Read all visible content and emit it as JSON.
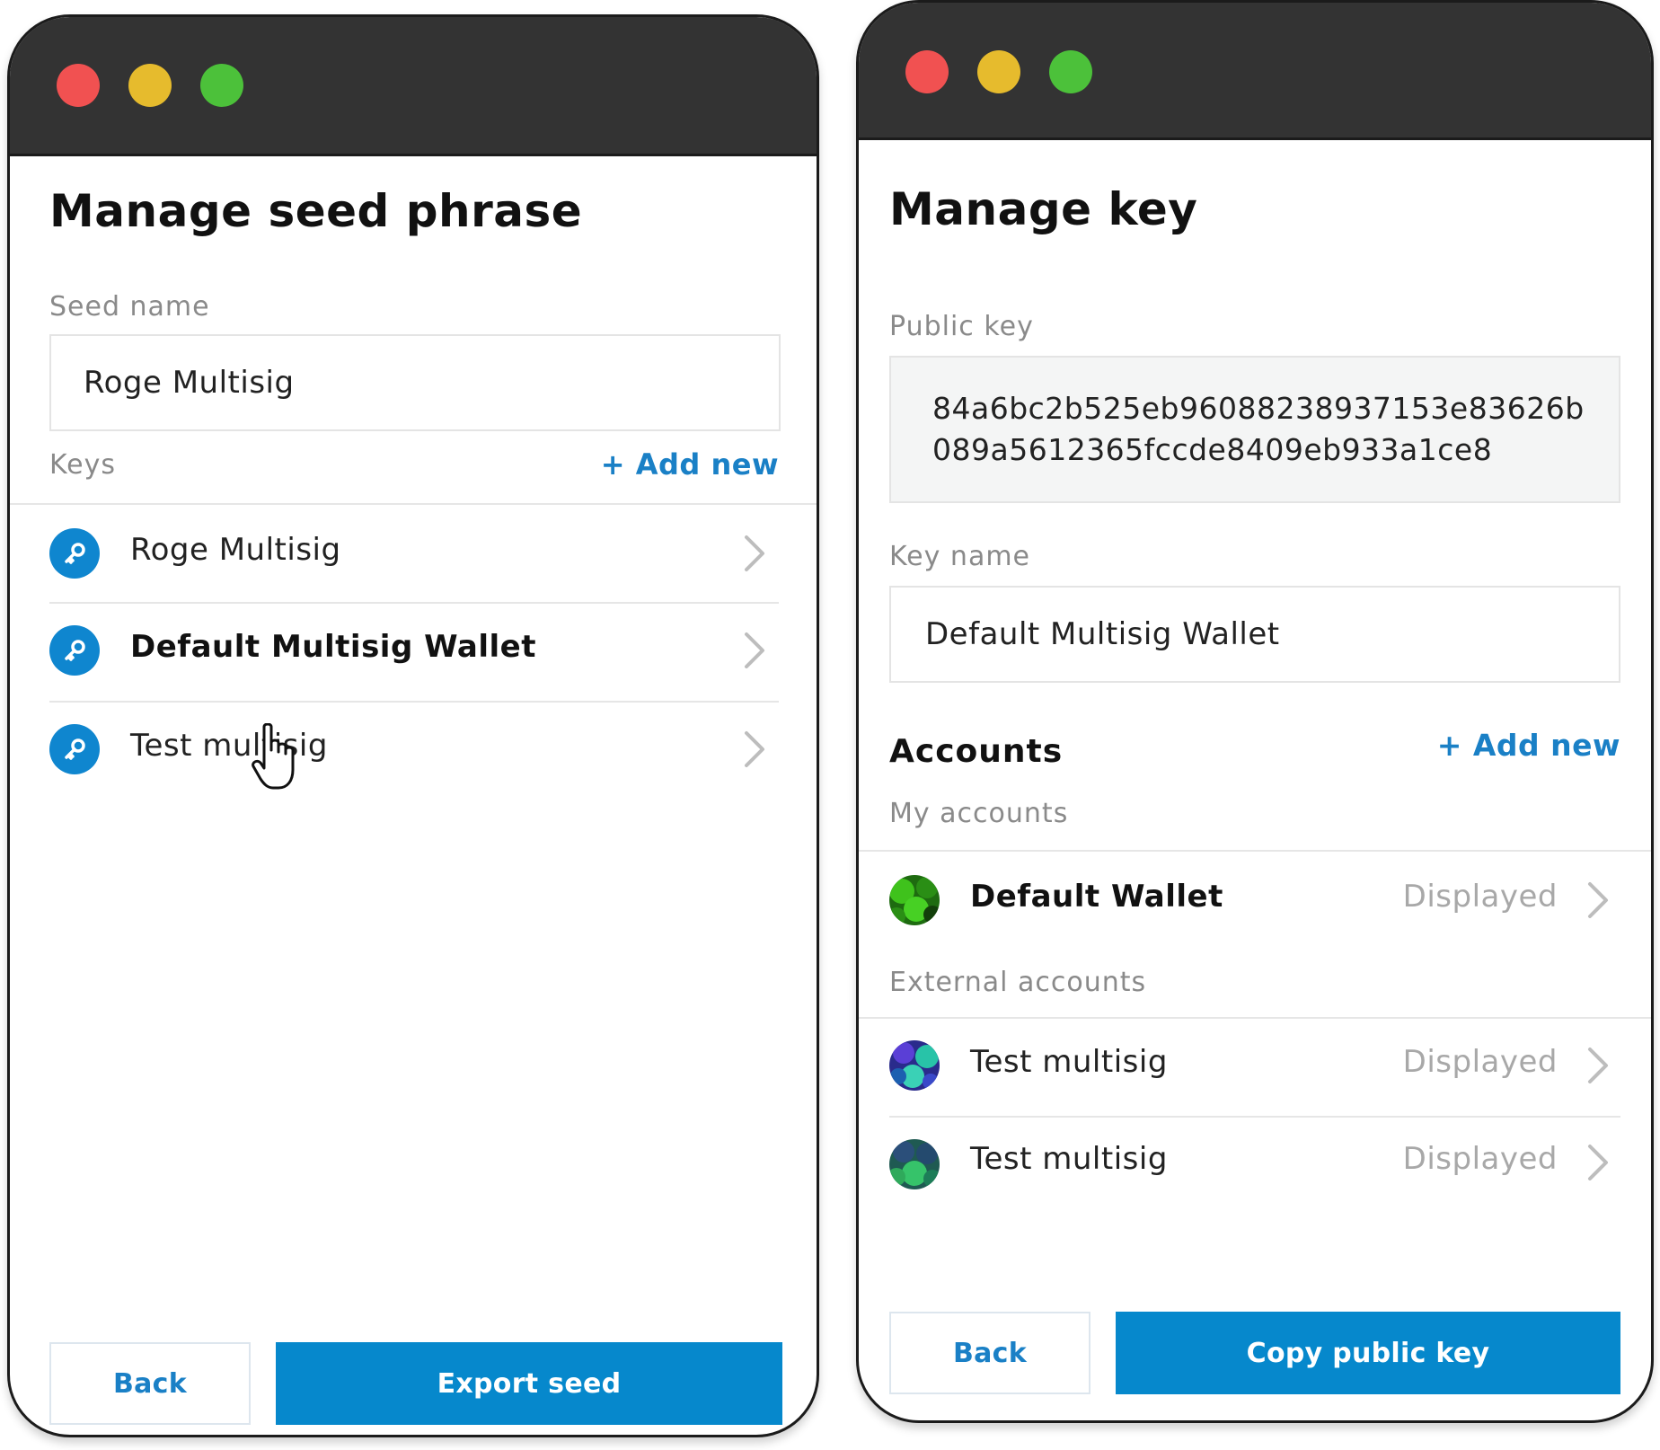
{
  "left": {
    "title": "Manage seed phrase",
    "seed_name_label": "Seed name",
    "seed_name_value": "Roge Multisig",
    "keys_label": "Keys",
    "add_new": "+ Add new",
    "keys": [
      {
        "label": "Roge Multisig",
        "icon": "key-icon"
      },
      {
        "label": "Default Multisig Wallet",
        "icon": "key-icon"
      },
      {
        "label": "Test multisig",
        "icon": "key-icon"
      }
    ],
    "back_button": "Back",
    "primary_button": "Export seed"
  },
  "right": {
    "title": "Manage key",
    "public_key_label": "Public key",
    "public_key_line1": "84a6bc2b525eb96088238937153e83626b",
    "public_key_line2": "089a5612365fccde8409eb933a1ce8",
    "key_name_label": "Key name",
    "key_name_value": "Default Multisig Wallet",
    "accounts_heading": "Accounts",
    "add_new": "+ Add new",
    "my_accounts_label": "My accounts",
    "my_accounts": [
      {
        "name": "Default Wallet",
        "status": "Displayed"
      }
    ],
    "external_accounts_label": "External accounts",
    "external_accounts": [
      {
        "name": "Test multisig",
        "status": "Displayed"
      },
      {
        "name": "Test multisig",
        "status": "Displayed"
      }
    ],
    "back_button": "Back",
    "primary_button": "Copy public key"
  },
  "colors": {
    "accent": "#0688cc",
    "link": "#1a80c6",
    "titlebar": "#333333",
    "traffic_red": "#f15151",
    "traffic_yellow": "#e6bb2d",
    "traffic_green": "#4cc13a"
  }
}
